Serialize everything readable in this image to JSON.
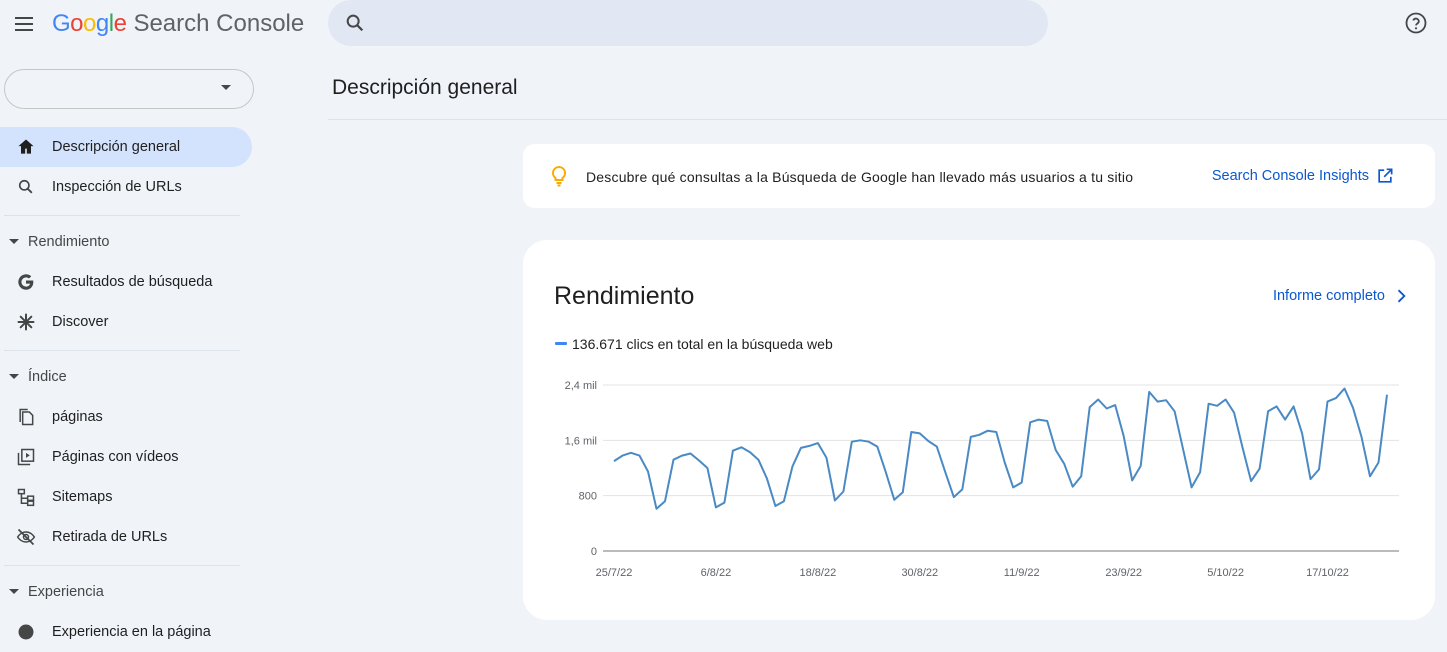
{
  "app": {
    "logo_google": "Google",
    "logo_product": "Search Console"
  },
  "search": {
    "placeholder": ""
  },
  "sidebar": {
    "property_value": "",
    "items": [
      {
        "label": "Descripción general",
        "icon": "home-icon",
        "active": true
      },
      {
        "label": "Inspección de URLs",
        "icon": "search-icon"
      }
    ],
    "sections": [
      {
        "label": "Rendimiento",
        "items": [
          {
            "label": "Resultados de búsqueda",
            "icon": "google-g-icon"
          },
          {
            "label": "Discover",
            "icon": "asterisk-icon"
          }
        ]
      },
      {
        "label": "Índice",
        "items": [
          {
            "label": "páginas",
            "icon": "file-copy-icon"
          },
          {
            "label": "Páginas con vídeos",
            "icon": "video-page-icon"
          },
          {
            "label": "Sitemaps",
            "icon": "sitemap-icon"
          },
          {
            "label": "Retirada de URLs",
            "icon": "visibility-off-icon"
          }
        ]
      },
      {
        "label": "Experiencia",
        "items": [
          {
            "label": "Experiencia en la página",
            "icon": "experience-icon"
          }
        ]
      }
    ]
  },
  "main": {
    "title": "Descripción general",
    "insight": {
      "text": "Descubre qué consultas a la Búsqueda de Google han llevado más usuarios a tu sitio",
      "link": "Search Console Insights"
    },
    "performance": {
      "title": "Rendimiento",
      "full_report": "Informe completo",
      "legend": "136.671 clics en total en la búsqueda web"
    }
  },
  "colors": {
    "accent": "#0b57d0",
    "series": "#4a8ac4",
    "active_nav": "#d3e3fd",
    "bulb": "#f9ab00"
  },
  "chart_data": {
    "type": "line",
    "xlabel": "",
    "ylabel": "",
    "y_ticks": [
      {
        "value": 0,
        "label": "0"
      },
      {
        "value": 800,
        "label": "800"
      },
      {
        "value": 1600,
        "label": "1,6 mil"
      },
      {
        "value": 2400,
        "label": "2,4 mil"
      }
    ],
    "ylim": [
      0,
      2400
    ],
    "x_ticks": [
      {
        "index": 0,
        "label": "25/7/22"
      },
      {
        "index": 12,
        "label": "6/8/22"
      },
      {
        "index": 24,
        "label": "18/8/22"
      },
      {
        "index": 36,
        "label": "30/8/22"
      },
      {
        "index": 48,
        "label": "11/9/22"
      },
      {
        "index": 60,
        "label": "23/9/22"
      },
      {
        "index": 72,
        "label": "5/10/22"
      },
      {
        "index": 84,
        "label": "17/10/22"
      }
    ],
    "grid": true,
    "series": [
      {
        "name": "136.671 clics en total en la búsqueda web",
        "values": [
          1300,
          1380,
          1420,
          1380,
          1150,
          610,
          720,
          1320,
          1380,
          1410,
          1310,
          1200,
          630,
          700,
          1450,
          1500,
          1430,
          1320,
          1050,
          650,
          720,
          1220,
          1490,
          1520,
          1560,
          1350,
          730,
          860,
          1580,
          1600,
          1580,
          1510,
          1140,
          740,
          850,
          1720,
          1700,
          1590,
          1510,
          1140,
          780,
          890,
          1650,
          1680,
          1740,
          1720,
          1280,
          920,
          990,
          1860,
          1900,
          1880,
          1460,
          1260,
          930,
          1080,
          2080,
          2190,
          2060,
          2110,
          1660,
          1020,
          1230,
          2300,
          2160,
          2180,
          2020,
          1470,
          920,
          1140,
          2130,
          2100,
          2190,
          2000,
          1490,
          1010,
          1190,
          2020,
          2090,
          1900,
          2090,
          1700,
          1040,
          1180,
          2160,
          2210,
          2350,
          2070,
          1650,
          1080,
          1280,
          2260
        ]
      }
    ]
  }
}
